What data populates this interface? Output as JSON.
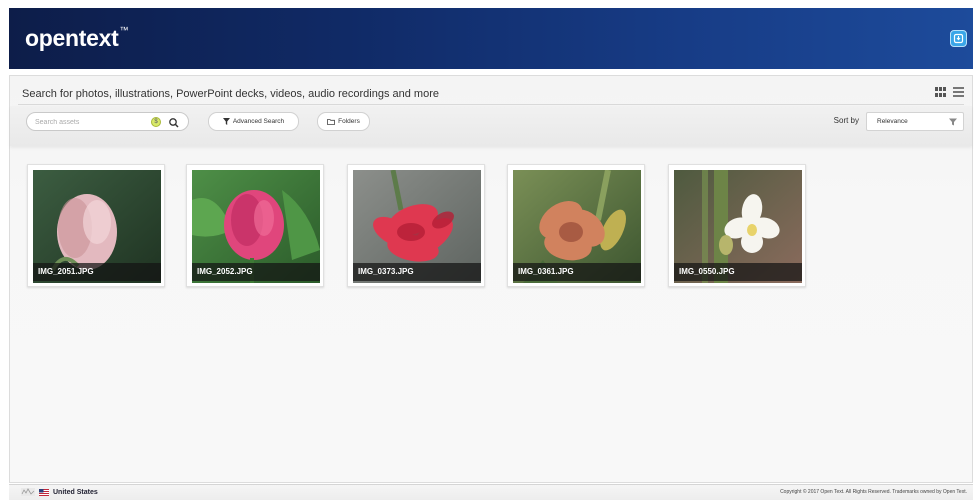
{
  "header": {
    "logo": "opentext",
    "logo_tm": "™",
    "icon": "download-icon"
  },
  "search": {
    "title": "Search for photos, illustrations, PowerPoint decks, videos, audio recordings and more",
    "placeholder": "Search assets",
    "badge": "$",
    "advanced_label": "Advanced Search",
    "folders_label": "Folders",
    "sort_label": "Sort by",
    "sort_value": "Relevance"
  },
  "view_icons": [
    "grid-view-icon",
    "list-view-icon"
  ],
  "assets": [
    {
      "name": "IMG_2051.JPG",
      "flower": "pink-peony-bud",
      "colors": {
        "bg1": "#3c5d41",
        "bg2": "#1f3322",
        "petal": "#e3b9bf",
        "petal2": "#c99298"
      }
    },
    {
      "name": "IMG_2052.JPG",
      "flower": "magenta-peony-bud",
      "colors": {
        "bg1": "#4e8f47",
        "bg2": "#2b5b2a",
        "petal": "#e0467c",
        "petal2": "#b8275b"
      }
    },
    {
      "name": "IMG_0373.JPG",
      "flower": "red-lily-double",
      "colors": {
        "bg1": "#8c8f8b",
        "bg2": "#5e6460",
        "petal": "#df3850",
        "petal2": "#b51f36"
      }
    },
    {
      "name": "IMG_0361.JPG",
      "flower": "peach-lily",
      "colors": {
        "bg1": "#7a8f56",
        "bg2": "#3d5630",
        "petal": "#d1825e",
        "petal2": "#a85b43"
      }
    },
    {
      "name": "IMG_0550.JPG",
      "flower": "white-orchid",
      "colors": {
        "bg1": "#4e5a3f",
        "bg2": "#8b6b5d",
        "petal": "#f6f5ef",
        "petal2": "#d9dbc9"
      }
    }
  ],
  "footer": {
    "region": "United States",
    "copyright": "Copyright © 2017 Open Text. All Rights Reserved. Trademarks owned by Open Text."
  }
}
